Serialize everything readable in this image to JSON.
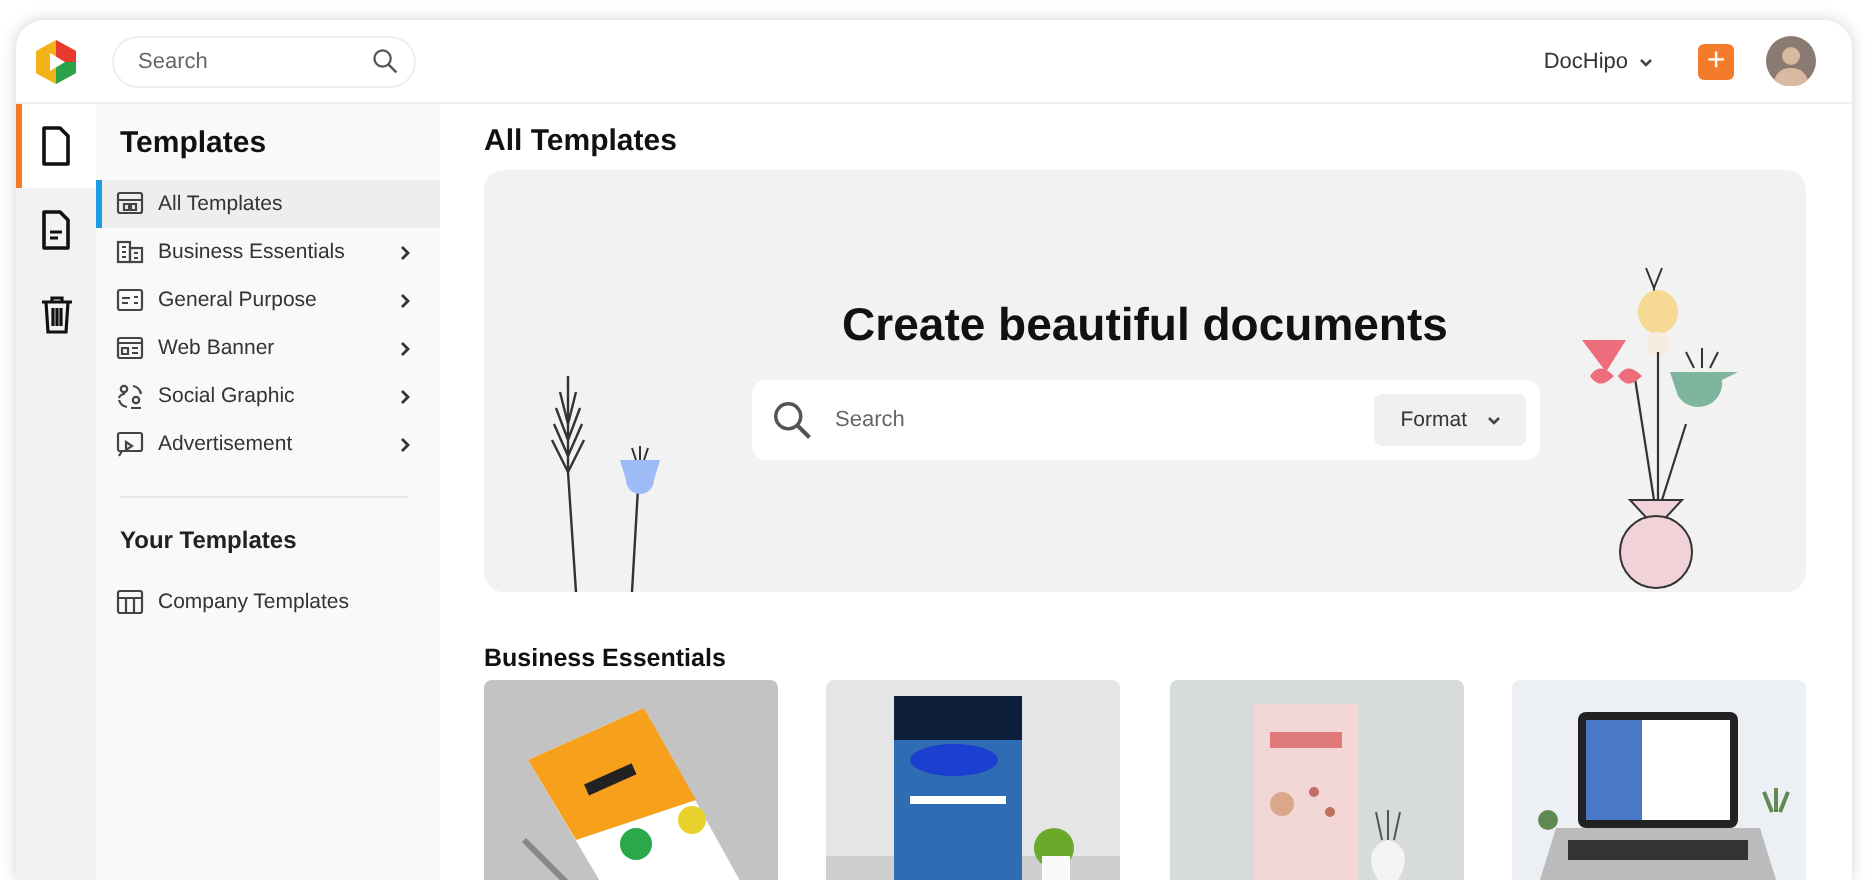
{
  "header": {
    "search": {
      "placeholder": "Search"
    },
    "workspace": "DocHipo",
    "add_button": "+"
  },
  "rail": [
    {
      "selected": true
    },
    {
      "selected": false
    },
    {
      "selected": false
    }
  ],
  "sidebar": {
    "title": "Templates",
    "items": [
      {
        "label": "All Templates",
        "selected": true,
        "has_submenu": false
      },
      {
        "label": "Business Essentials",
        "selected": false,
        "has_submenu": true
      },
      {
        "label": "General Purpose",
        "selected": false,
        "has_submenu": true
      },
      {
        "label": "Web Banner",
        "selected": false,
        "has_submenu": true
      },
      {
        "label": "Social Graphic",
        "selected": false,
        "has_submenu": true
      },
      {
        "label": "Advertisement",
        "selected": false,
        "has_submenu": true
      }
    ],
    "section_title": "Your Templates",
    "your_items": [
      {
        "label": "Company Templates",
        "selected": false,
        "has_submenu": false
      }
    ]
  },
  "main": {
    "title": "All Templates",
    "hero": {
      "heading": "Create beautiful documents",
      "search": {
        "placeholder": "Search"
      },
      "format_button": "Format"
    },
    "section_title": "Business Essentials"
  }
}
